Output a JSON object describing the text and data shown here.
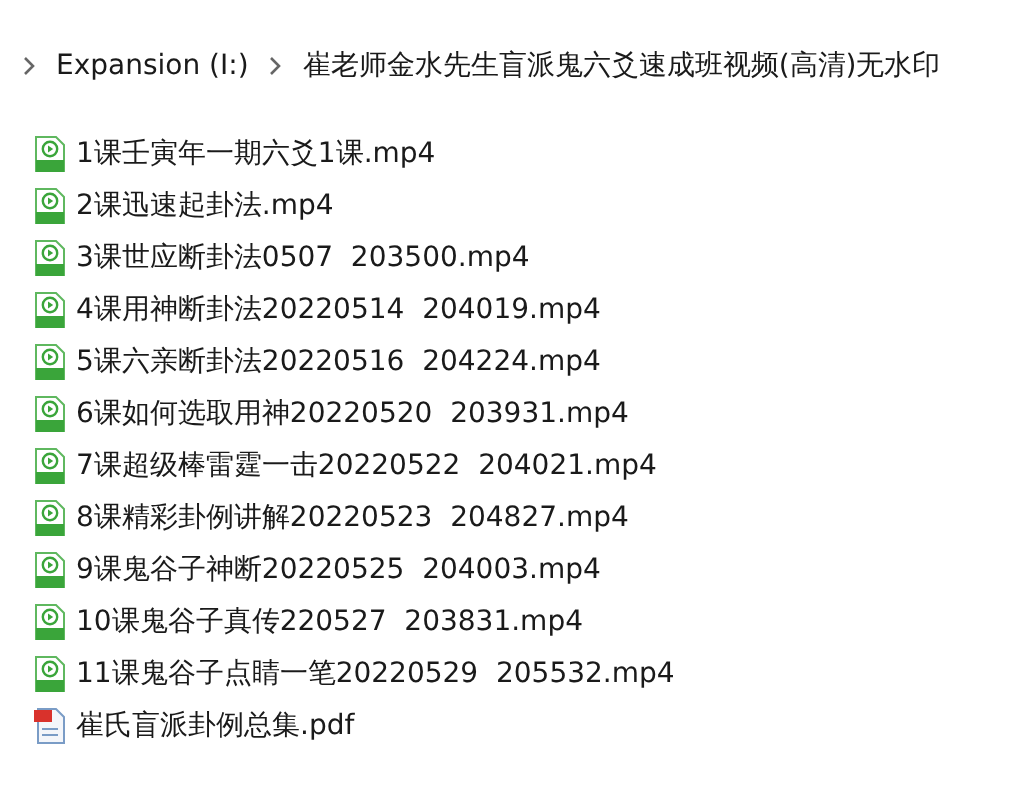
{
  "breadcrumb": [
    {
      "label": "Expansion (I:)"
    },
    {
      "label": "崔老师金水先生盲派鬼六爻速成班视频(高清)无水印"
    }
  ],
  "files": [
    {
      "name": "1课壬寅年一期六爻1课.mp4",
      "kind": "video"
    },
    {
      "name": "2课迅速起卦法.mp4",
      "kind": "video"
    },
    {
      "name": "3课世应断卦法0507  203500.mp4",
      "kind": "video"
    },
    {
      "name": "4课用神断卦法20220514  204019.mp4",
      "kind": "video"
    },
    {
      "name": "5课六亲断卦法20220516  204224.mp4",
      "kind": "video"
    },
    {
      "name": "6课如何选取用神20220520  203931.mp4",
      "kind": "video"
    },
    {
      "name": "7课超级棒雷霆一击20220522  204021.mp4",
      "kind": "video"
    },
    {
      "name": "8课精彩卦例讲解20220523  204827.mp4",
      "kind": "video"
    },
    {
      "name": "9课鬼谷子神断20220525  204003.mp4",
      "kind": "video"
    },
    {
      "name": "10课鬼谷子真传220527  203831.mp4",
      "kind": "video"
    },
    {
      "name": "11课鬼谷子点睛一笔20220529  205532.mp4",
      "kind": "video"
    },
    {
      "name": "崔氏盲派卦例总集.pdf",
      "kind": "pdf"
    }
  ]
}
